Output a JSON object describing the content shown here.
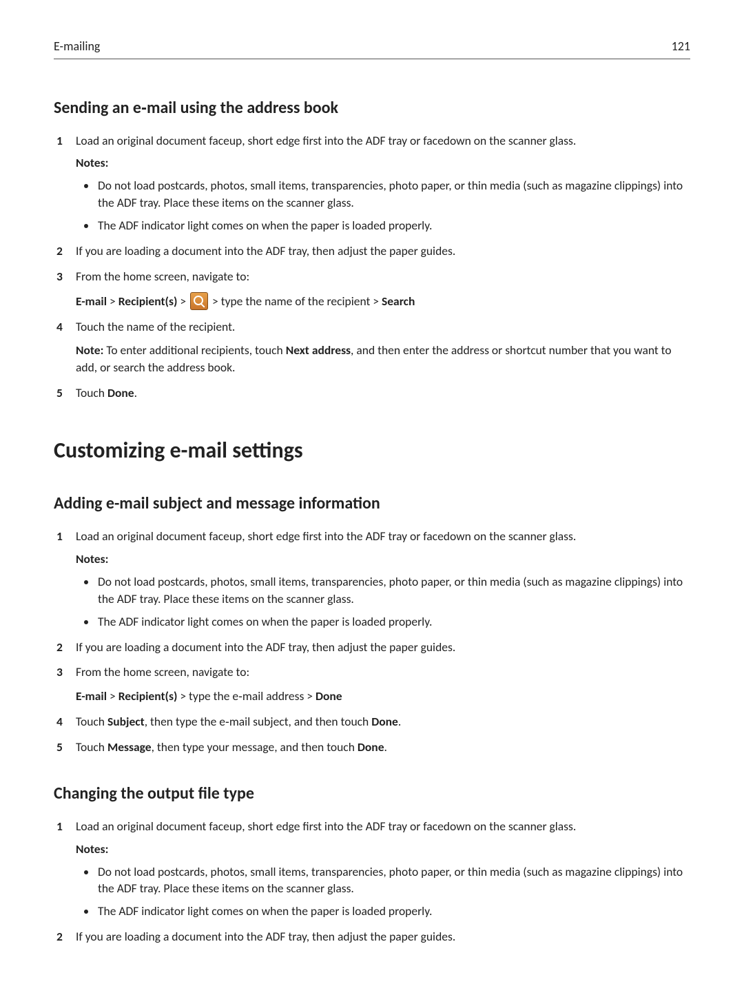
{
  "header": {
    "section": "E-mailing",
    "page": "121"
  },
  "sec1": {
    "title": "Sending an e‑mail using the address book",
    "step1": "Load an original document faceup, short edge first into the ADF tray or facedown on the scanner glass.",
    "notes_label": "Notes:",
    "note_a": "Do not load postcards, photos, small items, transparencies, photo paper, or thin media (such as magazine clippings) into the ADF tray. Place these items on the scanner glass.",
    "note_b": "The ADF indicator light comes on when the paper is loaded properly.",
    "step2": "If you are loading a document into the ADF tray, then adjust the paper guides.",
    "step3": "From the home screen, navigate to:",
    "path_email": "E-mail",
    "path_recip": "Recipient(s)",
    "path_mid": " > type the name of the recipient > ",
    "path_search": "Search",
    "step4": "Touch the name of the recipient.",
    "note2_label": "Note:",
    "note2_a": " To enter additional recipients, touch ",
    "note2_bold": "Next address",
    "note2_b": ", and then enter the address or shortcut number that you want to add, or search the address book.",
    "step5_pre": "Touch ",
    "step5_bold": "Done",
    "step5_post": "."
  },
  "big_title": "Customizing e-mail settings",
  "sec2": {
    "title": "Adding e-mail subject and message information",
    "step1": "Load an original document faceup, short edge first into the ADF tray or facedown on the scanner glass.",
    "notes_label": "Notes:",
    "note_a": "Do not load postcards, photos, small items, transparencies, photo paper, or thin media (such as magazine clippings) into the ADF tray. Place these items on the scanner glass.",
    "note_b": "The ADF indicator light comes on when the paper is loaded properly.",
    "step2": "If you are loading a document into the ADF tray, then adjust the paper guides.",
    "step3": "From the home screen, navigate to:",
    "path_email": "E-mail",
    "path_recip": "Recipient(s)",
    "path_mid": " > type the e‑mail address > ",
    "path_done": "Done",
    "step4_pre": "Touch ",
    "step4_b1": "Subject",
    "step4_mid": ", then type the e‑mail subject, and then touch ",
    "step4_b2": "Done",
    "step4_post": ".",
    "step5_pre": "Touch ",
    "step5_b1": "Message",
    "step5_mid": ", then type your message, and then touch ",
    "step5_b2": "Done",
    "step5_post": "."
  },
  "sec3": {
    "title": "Changing the output file type",
    "step1": "Load an original document faceup, short edge first into the ADF tray or facedown on the scanner glass.",
    "notes_label": "Notes:",
    "note_a": "Do not load postcards, photos, small items, transparencies, photo paper, or thin media (such as magazine clippings) into the ADF tray. Place these items on the scanner glass.",
    "note_b": "The ADF indicator light comes on when the paper is loaded properly.",
    "step2": "If you are loading a document into the ADF tray, then adjust the paper guides."
  },
  "gt": ">"
}
